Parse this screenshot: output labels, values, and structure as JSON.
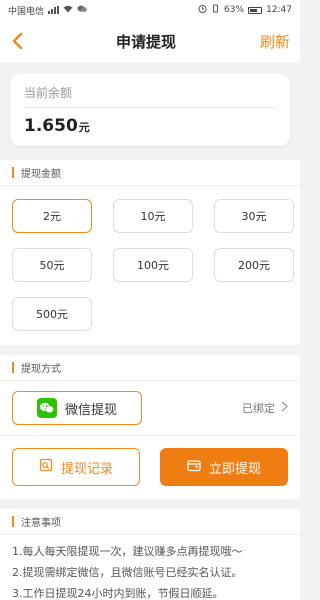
{
  "statusbar": {
    "carrier": "中国电信",
    "battery": "63%",
    "time": "12:47"
  },
  "navbar": {
    "title": "申请提现",
    "refresh_label": "刷新"
  },
  "balance": {
    "label": "当前余额",
    "value": "1.650",
    "unit": "元"
  },
  "amount_section": {
    "title": "提现金额",
    "options": [
      "2元",
      "10元",
      "30元",
      "50元",
      "100元",
      "200元",
      "500元"
    ],
    "selected": "2元"
  },
  "method_section": {
    "title": "提现方式",
    "method_label": "微信提现",
    "bound_status": "已绑定"
  },
  "actions": {
    "record_label": "提现记录",
    "withdraw_label": "立即提现"
  },
  "notes": {
    "title": "注意事项",
    "items": [
      "1.每人每天限提现一次，建议赚多点再提现哦～",
      "2.提现需绑定微信，且微信账号已经实名认证。",
      "3.工作日提现24小时内到账，节假日顺延。"
    ]
  },
  "colors": {
    "accent": "#f28a1e",
    "button_fill": "#f07d12",
    "wechat_green": "#2dc100"
  }
}
